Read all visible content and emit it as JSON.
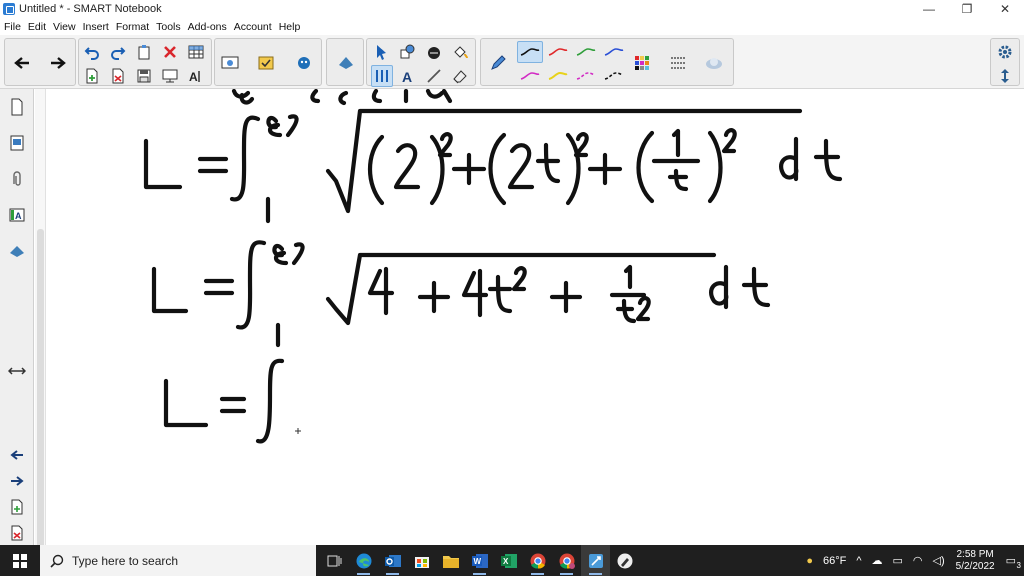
{
  "window": {
    "title": "Untitled * - SMART Notebook",
    "controls": [
      "—",
      "❐",
      "✕"
    ]
  },
  "menu": [
    "File",
    "Edit",
    "View",
    "Insert",
    "Format",
    "Tools",
    "Add-ons",
    "Account",
    "Help"
  ],
  "taskbar": {
    "search_placeholder": "Type here to search",
    "weather": "66°F",
    "time": "2:58 PM",
    "date": "5/2/2022",
    "notification_count": "3"
  },
  "colors": {
    "pen_black": "#111111",
    "pen_red": "#e0282a",
    "pen_green": "#2f9e3a",
    "pen_blue": "#2a4fd6",
    "pen_magenta": "#d22bc4",
    "pen_yellow": "#e8d21a",
    "accent_blue": "#2b7cd3",
    "taskbar_bg": "#1f1f1f"
  },
  "icons": {
    "toolbar": [
      "back-arrow-icon",
      "forward-arrow-icon",
      "undo-icon",
      "redo-icon",
      "paste-icon",
      "delete-icon",
      "table-icon",
      "screen-shade-icon",
      "add-page-icon",
      "remove-page-icon",
      "save-icon",
      "fullscreen-icon",
      "text-recognition-icon",
      "document-camera-icon",
      "response-icon",
      "activity-builder-icon",
      "lab-icon",
      "select-icon",
      "shapes-icon",
      "fill-icon",
      "eraser-icon",
      "pen-icon",
      "text-icon",
      "line-icon",
      "pen-style-icon",
      "color-palette-icon",
      "line-settings-icon",
      "fill-effects-icon",
      "settings-gear-icon",
      "move-toolbar-icon"
    ],
    "sidebar": [
      "page-sorter-icon",
      "gallery-icon",
      "attachments-icon",
      "properties-icon",
      "add-ons-icon",
      "resize-sidebar-icon",
      "prev-page-icon",
      "next-page-icon",
      "add-page-icon",
      "delete-page-icon"
    ]
  }
}
